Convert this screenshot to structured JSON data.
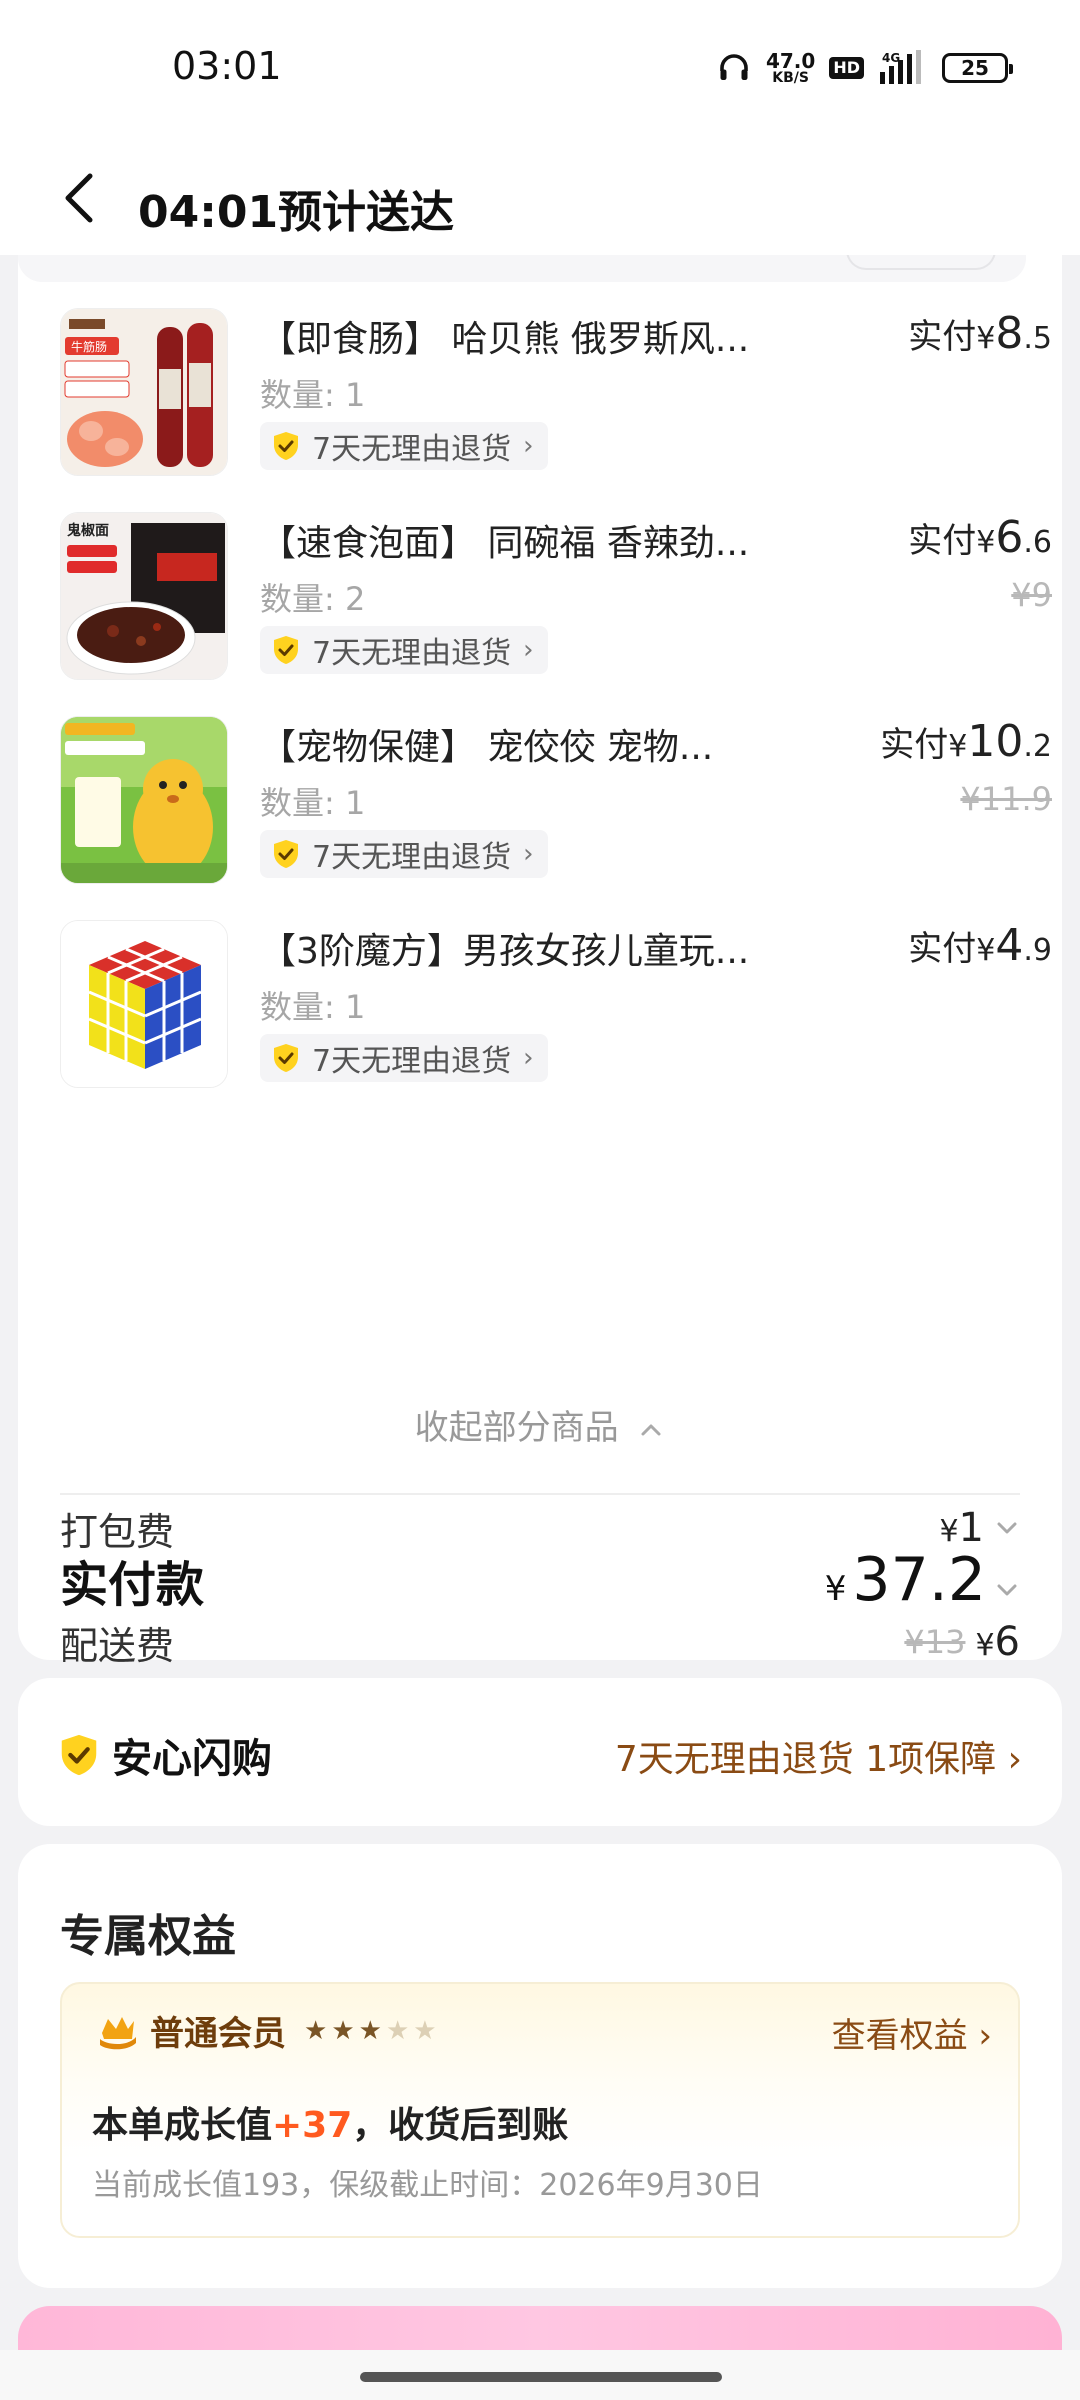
{
  "status_bar": {
    "time": "03:01",
    "net_speed_value": "47.0",
    "net_speed_unit": "KB/S",
    "hd": "HD",
    "network": "4G",
    "battery": "25"
  },
  "header": {
    "title": "04:01预计送达"
  },
  "items": [
    {
      "name": "【即食肠】 哈贝熊 俄罗斯风...",
      "qty": "数量: 1",
      "return_tag": "7天无理由退货",
      "price_label": "实付",
      "currency": "¥",
      "price_int": "8",
      "price_dec": ".5",
      "original_price": "",
      "thumb_icon": "sausage-product-image"
    },
    {
      "name": "【速食泡面】 同碗福 香辣劲...",
      "qty": "数量: 2",
      "return_tag": "7天无理由退货",
      "price_label": "实付",
      "currency": "¥",
      "price_int": "6",
      "price_dec": ".6",
      "original_price": "¥9",
      "thumb_icon": "instant-noodle-product-image"
    },
    {
      "name": "【宠物保健】 宠佼佼 宠物...",
      "qty": "数量: 1",
      "return_tag": "7天无理由退货",
      "price_label": "实付",
      "currency": "¥",
      "price_int": "10",
      "price_dec": ".2",
      "original_price": "¥11.9",
      "thumb_icon": "pet-health-product-image"
    },
    {
      "name": "【3阶魔方】男孩女孩儿童玩...",
      "qty": "数量: 1",
      "return_tag": "7天无理由退货",
      "price_label": "实付",
      "currency": "¥",
      "price_int": "4",
      "price_dec": ".9",
      "original_price": "",
      "thumb_icon": "rubiks-cube-product-image"
    }
  ],
  "collapse_label": "收起部分商品",
  "packing_fee": {
    "label": "打包费",
    "currency": "¥",
    "value": "1"
  },
  "delivery_fee": {
    "label": "配送费",
    "original": "¥13",
    "currency": "¥",
    "value": "6"
  },
  "total": {
    "label": "实付款",
    "currency": "¥",
    "value": "37.2"
  },
  "guarantee": {
    "title": "安心闪购",
    "detail": "7天无理由退货 1项保障"
  },
  "benefits": {
    "title": "专属权益",
    "member_level": "普通会员",
    "stars_filled": 3,
    "stars_total": 5,
    "view_link": "查看权益",
    "growth_prefix": "本单成长值",
    "growth_value": "+37",
    "growth_suffix": "，收货后到账",
    "growth_sub": "当前成长值193，保级截止时间：2026年9月30日"
  },
  "colors": {
    "accent_orange": "#ff5a1f",
    "brown_text": "#8a4b14",
    "shield_yellow": "#ffd21f",
    "pink_banner": "#ffb7d8"
  }
}
